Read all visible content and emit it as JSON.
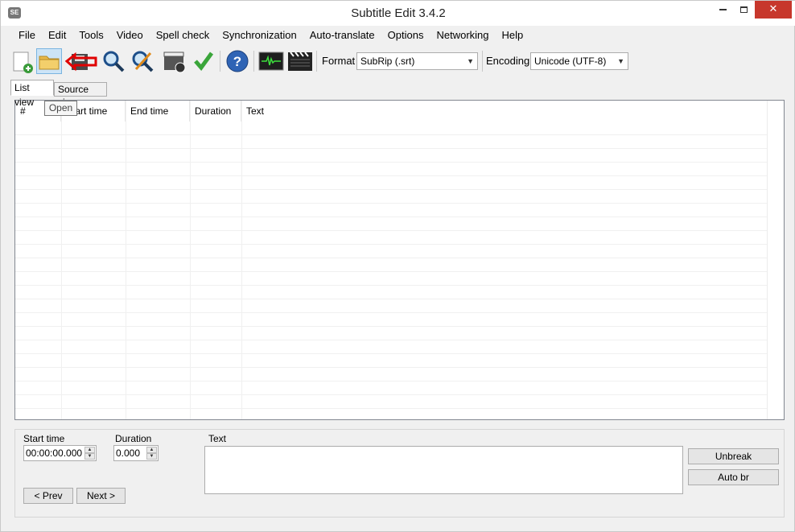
{
  "window": {
    "title": "Subtitle Edit 3.4.2",
    "app_icon_text": "SE"
  },
  "menu": [
    "File",
    "Edit",
    "Tools",
    "Video",
    "Spell check",
    "Synchronization",
    "Auto-translate",
    "Options",
    "Networking",
    "Help"
  ],
  "toolbar": {
    "format_label": "Format",
    "format_value": "SubRip (.srt)",
    "encoding_label": "Encoding",
    "encoding_value": "Unicode (UTF-8)",
    "tooltip": "Open",
    "icons": [
      "new-file-icon",
      "open-folder-icon",
      "save-icon",
      "find-icon",
      "replace-icon",
      "visual-sync-icon",
      "spell-check-icon",
      "help-icon",
      "waveform-icon",
      "video-clapper-icon"
    ],
    "highlight_color": "#e00000"
  },
  "tabs": {
    "list_view": "List view",
    "source_view": "Source view"
  },
  "grid": {
    "columns": [
      "#",
      "Start time",
      "End time",
      "Duration",
      "Text"
    ]
  },
  "edit_panel": {
    "start_time_label": "Start time",
    "start_time_value": "00:00:00.000",
    "duration_label": "Duration",
    "duration_value": "0.000",
    "text_label": "Text",
    "unbreak_label": "Unbreak",
    "auto_br_label": "Auto br",
    "prev_label": "< Prev",
    "next_label": "Next >"
  }
}
